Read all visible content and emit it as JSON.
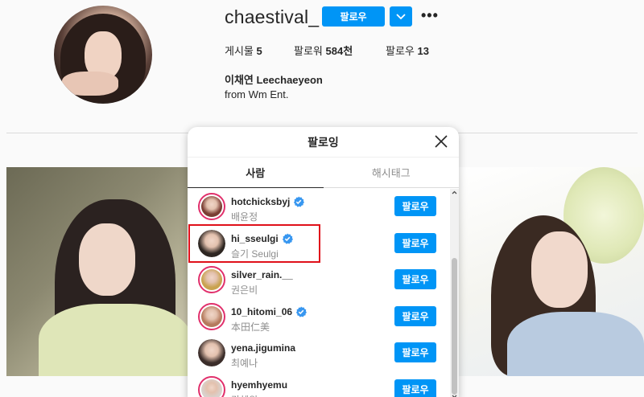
{
  "profile": {
    "username": "chaestival_",
    "follow_label": "팔로우",
    "stats": {
      "posts_label": "게시물",
      "posts_value": "5",
      "followers_label": "팔로워",
      "followers_value": "584천",
      "following_label": "팔로우",
      "following_value": "13"
    },
    "display_name": "이채연 Leechaeyeon",
    "bio": "from Wm Ent."
  },
  "modal": {
    "title": "팔로잉",
    "tabs": [
      {
        "label": "사람",
        "active": true
      },
      {
        "label": "해시태그",
        "active": false
      }
    ],
    "follow_label": "팔로우",
    "accounts": [
      {
        "username": "hotchicksbyj",
        "name": "배윤정",
        "verified": true,
        "story": true,
        "avatar_color": "#7a3d33"
      },
      {
        "username": "hi_sseulgi",
        "name": "슬기 Seulgi",
        "verified": true,
        "story": false,
        "avatar_color": "#2e2622",
        "highlighted": true
      },
      {
        "username": "silver_rain.__",
        "name": "권은비",
        "verified": false,
        "story": true,
        "avatar_color": "#c9a24f"
      },
      {
        "username": "10_hitomi_06",
        "name": "本田仁美",
        "verified": true,
        "story": true,
        "avatar_color": "#b57a5d"
      },
      {
        "username": "yena.jigumina",
        "name": "최예나",
        "verified": false,
        "story": false,
        "avatar_color": "#3b2d2a"
      },
      {
        "username": "hyemhyemu",
        "name": "강혜원",
        "verified": false,
        "story": true,
        "avatar_color": "#d9d1cc"
      }
    ]
  },
  "colors": {
    "accent": "#0095f6",
    "highlight": "#e0101a",
    "verified": "#3897f0"
  }
}
